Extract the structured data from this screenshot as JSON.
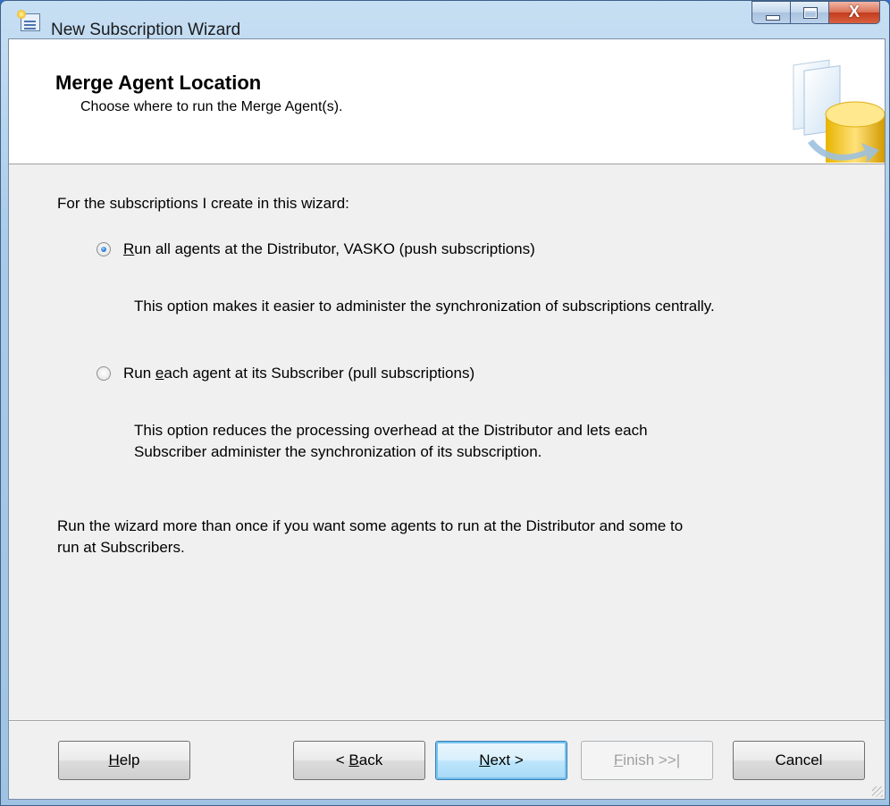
{
  "window": {
    "title": "New Subscription Wizard",
    "controls": {
      "minimize": "minimize",
      "maximize": "maximize",
      "close": "X"
    }
  },
  "header": {
    "title": "Merge Agent Location",
    "subtitle": "Choose where to run the Merge Agent(s)."
  },
  "body": {
    "intro": "For the subscriptions I create in this wizard:",
    "options": [
      {
        "mnemonic": "R",
        "label_rest": "un all agents at the Distributor, VASKO (push subscriptions)",
        "description": "This option makes it easier to administer the synchronization of subscriptions centrally.",
        "checked": true
      },
      {
        "label_pre": "Run ",
        "mnemonic": "e",
        "label_rest": "ach agent at its Subscriber (pull subscriptions)",
        "description_line1": "This option reduces the processing overhead at the Distributor and lets each",
        "description_line2": "Subscriber administer the synchronization of its subscription.",
        "checked": false
      }
    ],
    "note_line1": "Run the wizard more than once if you want some agents to run at the Distributor and some to",
    "note_line2": "run at Subscribers."
  },
  "buttons": {
    "help": {
      "mnemonic": "H",
      "rest": "elp"
    },
    "back": {
      "pre": "< ",
      "mnemonic": "B",
      "rest": "ack"
    },
    "next": {
      "mnemonic": "N",
      "rest": "ext >"
    },
    "finish": {
      "mnemonic": "F",
      "rest": "inish >>|",
      "enabled": false
    },
    "cancel": "Cancel"
  }
}
